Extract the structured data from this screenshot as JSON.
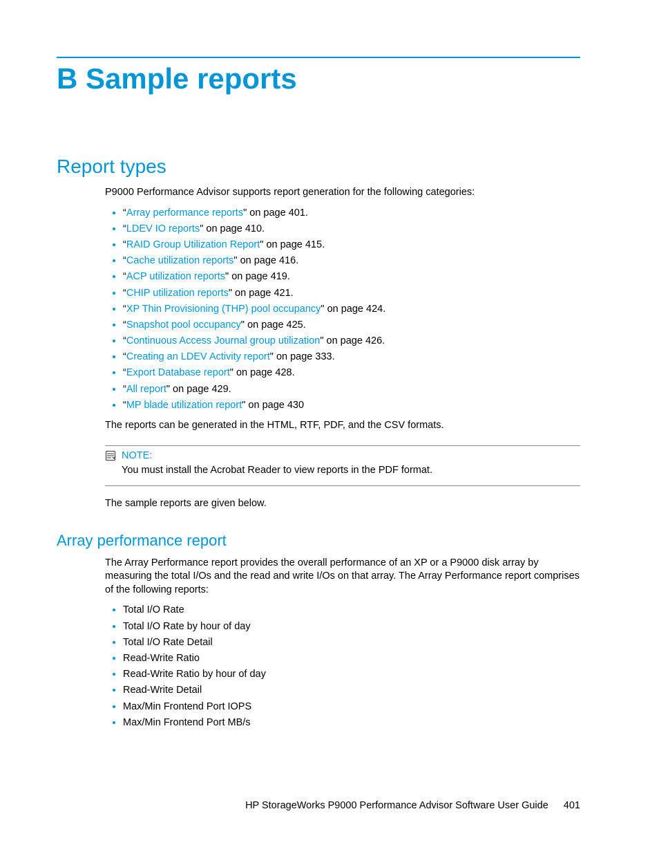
{
  "chapter_title": "B Sample reports",
  "section_title": "Report types",
  "intro_para": "P9000 Performance Advisor supports report generation for the following categories:",
  "links": [
    {
      "text": "Array performance reports",
      "suffix": "\" on page 401."
    },
    {
      "text": "LDEV IO reports",
      "suffix": "\" on page 410."
    },
    {
      "text": "RAID Group Utilization Report",
      "suffix": "\" on page 415."
    },
    {
      "text": "Cache utilization reports",
      "suffix": "\" on page 416."
    },
    {
      "text": "ACP utilization reports",
      "suffix": "\" on page 419."
    },
    {
      "text": "CHIP utilization reports",
      "suffix": "\" on page 421."
    },
    {
      "text": "XP Thin Provisioning (THP) pool occupancy",
      "suffix": "\" on page 424."
    },
    {
      "text": "Snapshot pool occupancy",
      "suffix": "\" on page 425."
    },
    {
      "text": "Continuous Access Journal group utilization",
      "suffix": "\" on page 426."
    },
    {
      "text": "Creating an LDEV Activity report",
      "suffix": "\" on page 333."
    },
    {
      "text": "Export Database report",
      "suffix": "\" on page 428."
    },
    {
      "text": "All report",
      "suffix": "\" on page 429."
    },
    {
      "text": "MP blade utilization report",
      "suffix": "\" on page 430"
    }
  ],
  "formats_para": "The reports can be generated in the HTML, RTF, PDF, and the CSV formats.",
  "note_label": "NOTE:",
  "note_body": "You must install the Acrobat Reader to view reports in the PDF format.",
  "sample_below": "The sample reports are given below.",
  "subsection_title": "Array performance report",
  "array_para": "The Array Performance report provides the overall performance of an XP or a P9000 disk array by measuring the total I/Os and the read and write I/Os on that array. The Array Performance report comprises of the following reports:",
  "array_items": [
    "Total I/O Rate",
    "Total I/O Rate by hour of day",
    "Total I/O Rate Detail",
    "Read-Write Ratio",
    "Read-Write Ratio by hour of day",
    "Read-Write Detail",
    "Max/Min Frontend Port IOPS",
    "Max/Min Frontend Port MB/s"
  ],
  "footer_text": "HP StorageWorks P9000 Performance Advisor Software User Guide",
  "page_number": "401"
}
